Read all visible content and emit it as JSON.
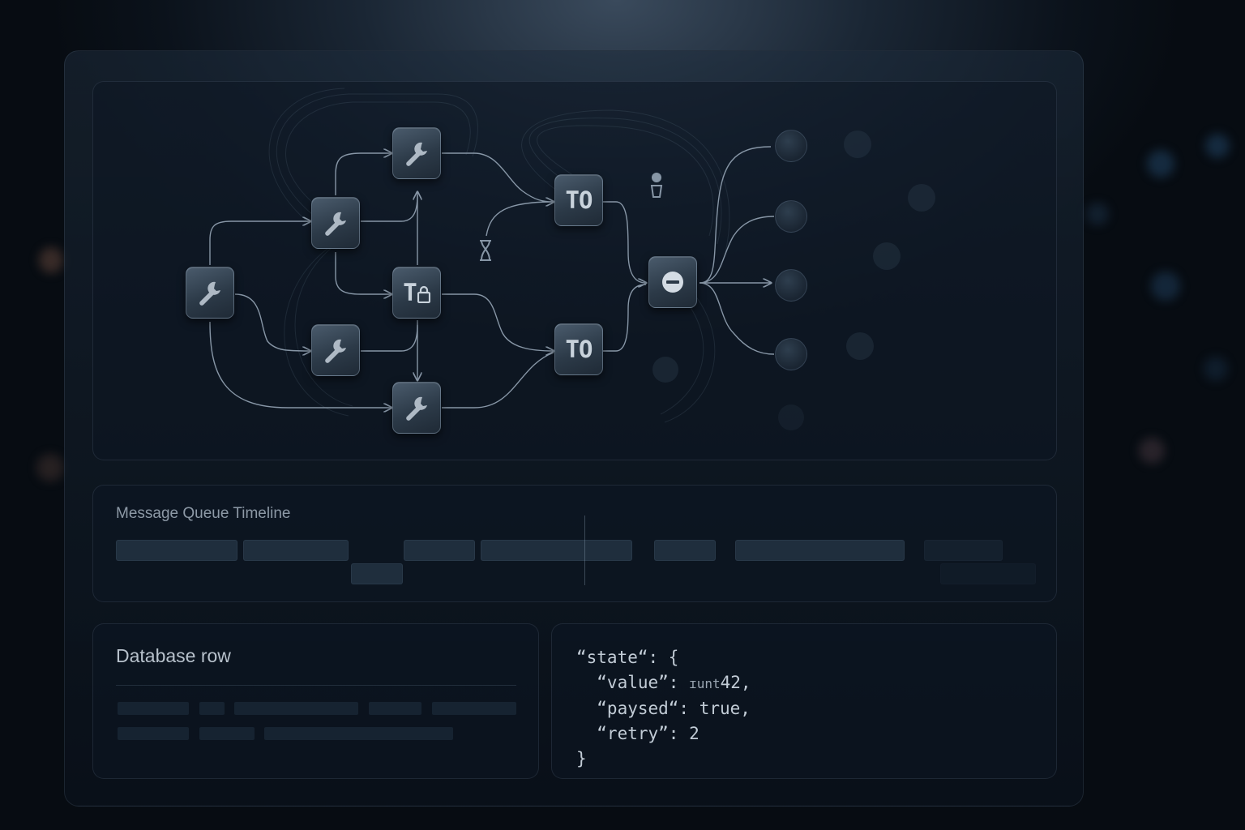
{
  "graph": {
    "tool_nodes": [
      {
        "id": "n1",
        "icon": "wrench-icon"
      },
      {
        "id": "n2",
        "icon": "wrench-icon"
      },
      {
        "id": "n3",
        "icon": "wrench-icon"
      },
      {
        "id": "n4",
        "icon": "wrench-icon"
      },
      {
        "id": "n5",
        "icon": "wrench-icon"
      }
    ],
    "text_nodes": {
      "to_lock": "T",
      "to_top": "TO",
      "to_bottom": "TO"
    },
    "merge_node_icon": "minus-circle-icon",
    "small_icons": [
      "hourglass-icon",
      "hourglass-icon"
    ],
    "output_count": 4,
    "colors": {
      "edge": "#8796a6",
      "node": "#2c3a48",
      "accent": "#c9d3dc"
    }
  },
  "timeline": {
    "title": "Message Queue Timeline"
  },
  "database": {
    "title": "Database row"
  },
  "json_view": {
    "line1": "“state“: {",
    "line2_key": "  “value”: ",
    "line2_type": "ɪunt",
    "line2_val": "42,",
    "line3": "  “paysed“: true,",
    "line4": "  “retry”: 2",
    "line5": "}"
  }
}
